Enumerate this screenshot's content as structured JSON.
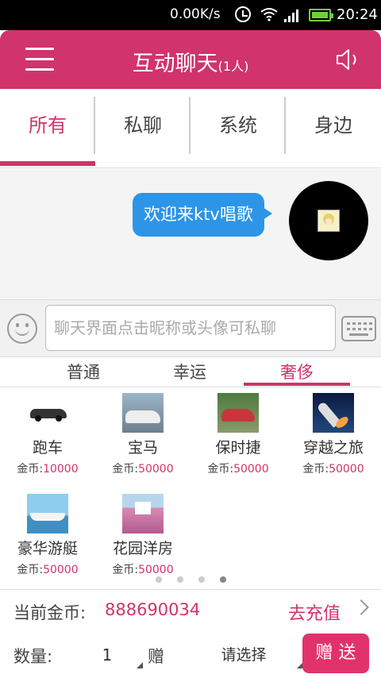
{
  "status_bar": {
    "speed": "0.00K/s",
    "time": "20:24"
  },
  "header": {
    "title": "互动聊天",
    "count": "(1人)"
  },
  "tabs": [
    {
      "label": "所有"
    },
    {
      "label": "私聊"
    },
    {
      "label": "系统"
    },
    {
      "label": "身边"
    }
  ],
  "chat": {
    "message": "欢迎来ktv唱歌"
  },
  "input": {
    "placeholder": "聊天界面点击昵称或头像可私聊"
  },
  "gift_tabs": [
    {
      "label": "普通"
    },
    {
      "label": "幸运"
    },
    {
      "label": "奢侈"
    }
  ],
  "gifts": [
    {
      "name": "跑车",
      "price_label": "金币:",
      "price": "10000",
      "icon": "sports-car"
    },
    {
      "name": "宝马",
      "price_label": "金币:",
      "price": "50000",
      "icon": "bmw-car"
    },
    {
      "name": "保时捷",
      "price_label": "金币:",
      "price": "50000",
      "icon": "porsche-car"
    },
    {
      "name": "穿越之旅",
      "price_label": "金币:",
      "price": "50000",
      "icon": "space-shuttle"
    },
    {
      "name": "豪华游艇",
      "price_label": "金币:",
      "price": "50000",
      "icon": "yacht"
    },
    {
      "name": "花园洋房",
      "price_label": "金币:",
      "price": "50000",
      "icon": "garden-villa"
    }
  ],
  "pager": {
    "current": 4,
    "total": 4
  },
  "coins": {
    "label": "当前金币:",
    "value": "888690034",
    "recharge": "去充值"
  },
  "send": {
    "qty_label": "数量:",
    "qty": "1",
    "give_label": "赠",
    "select": "请选择",
    "button": "赠 送"
  },
  "colors": {
    "accent": "#d1336b",
    "bubble": "#2d95e8"
  }
}
